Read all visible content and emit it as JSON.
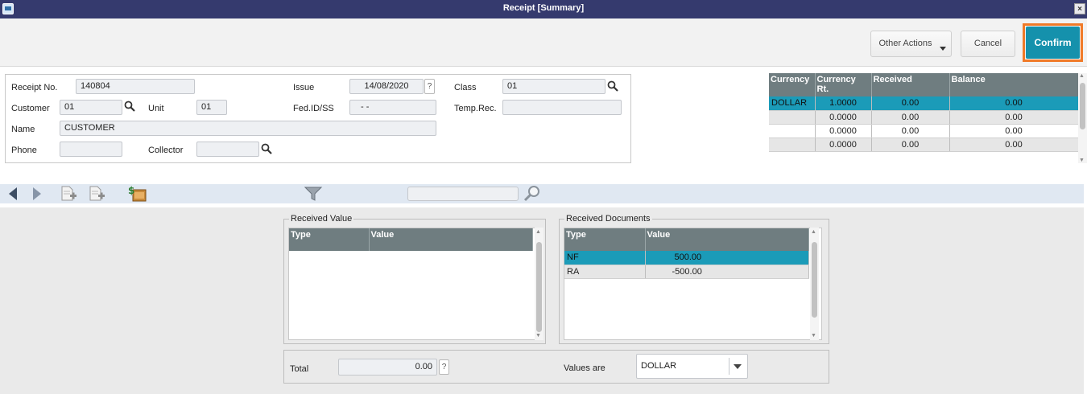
{
  "window": {
    "title": "Receipt [Summary]",
    "close_glyph": "×"
  },
  "actions": {
    "other_actions": "Other Actions",
    "cancel": "Cancel",
    "confirm": "Confirm",
    "accent": "#1591ac",
    "highlight": "#f07a28"
  },
  "form": {
    "receipt_no_label": "Receipt No.",
    "receipt_no": "140804",
    "issue_label": "Issue",
    "issue": "14/08/2020",
    "class_label": "Class",
    "class": "01",
    "customer_label": "Customer",
    "customer": "01",
    "unit_label": "Unit",
    "unit": "01",
    "fed_label": "Fed.ID/SS",
    "fed": "- -",
    "temp_label": "Temp.Rec.",
    "temp": "",
    "name_label": "Name",
    "name": "CUSTOMER",
    "phone_label": "Phone",
    "phone": "",
    "collector_label": "Collector",
    "collector": "",
    "help_glyph": "?"
  },
  "currency_grid": {
    "columns": [
      "Currency",
      "Currency Rt.",
      "Received",
      "Balance"
    ],
    "rows": [
      [
        "DOLLAR",
        "1.0000",
        "0.00",
        "0.00"
      ],
      [
        "",
        "0.0000",
        "0.00",
        "0.00"
      ],
      [
        "",
        "0.0000",
        "0.00",
        "0.00"
      ],
      [
        "",
        "0.0000",
        "0.00",
        "0.00"
      ]
    ]
  },
  "toolbar": {
    "search_value": ""
  },
  "received_value": {
    "title": "Received Value",
    "columns": [
      "Type",
      "Value"
    ],
    "rows": []
  },
  "received_documents": {
    "title": "Received Documents",
    "columns": [
      "Type",
      "Value"
    ],
    "rows": [
      [
        "NF",
        "500.00"
      ],
      [
        "RA",
        "-500.00"
      ]
    ]
  },
  "footer": {
    "total_label": "Total",
    "total": "0.00",
    "values_are_label": "Values are",
    "values_are": "DOLLAR"
  }
}
